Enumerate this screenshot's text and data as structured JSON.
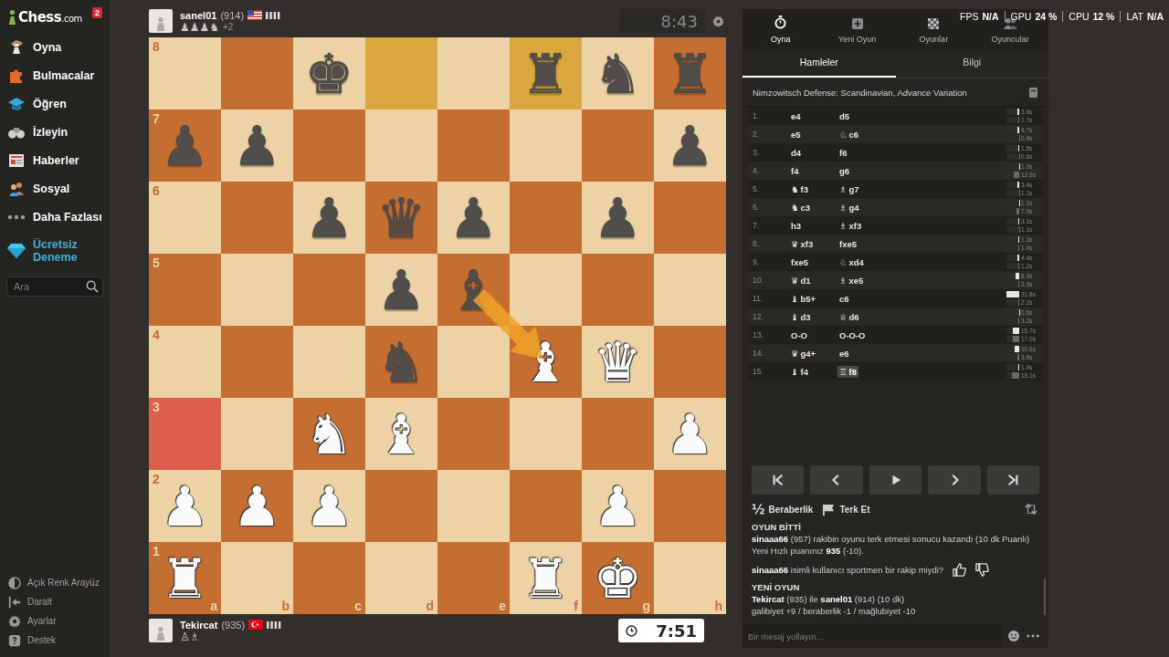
{
  "sidebar": {
    "logo": {
      "name": "Chess",
      "suffix": ".com"
    },
    "badge": "2",
    "items": [
      {
        "kind": "play",
        "label": "Oyna"
      },
      {
        "kind": "puzzles",
        "label": "Bulmacalar"
      },
      {
        "kind": "learn",
        "label": "Öğren"
      },
      {
        "kind": "watch",
        "label": "İzleyin"
      },
      {
        "kind": "news",
        "label": "Haberler"
      },
      {
        "kind": "social",
        "label": "Sosyal"
      },
      {
        "kind": "more",
        "label": "Daha Fazlası"
      },
      {
        "kind": "trial",
        "label": "Ücretsiz Deneme"
      }
    ],
    "search": {
      "placeholder": "Ara"
    },
    "footer": [
      {
        "kind": "theme",
        "label": "Açık Renk Arayüz"
      },
      {
        "kind": "collapse",
        "label": "Daralt"
      },
      {
        "kind": "settings",
        "label": "Ayarlar"
      },
      {
        "kind": "help",
        "label": "Destek"
      }
    ]
  },
  "players": [
    {
      "kind": "usa",
      "name": "sanel01",
      "rating": "(914)",
      "captured": "♟♟♟♞",
      "advantage": "+2",
      "clock": "8:43",
      "active": false
    },
    {
      "kind": "turkey",
      "name": "Tekircat",
      "rating": "(935)",
      "captured": "♙♗",
      "clock": "7:51",
      "active": true
    }
  ],
  "board": {
    "rank_labels": [
      "8",
      "7",
      "6",
      "5",
      "4",
      "3",
      "2",
      "1"
    ],
    "file_labels": [
      "a",
      "b",
      "c",
      "d",
      "e",
      "f",
      "g",
      "h"
    ],
    "rows": [
      [
        {},
        {},
        {
          "glyph": "♚",
          "white": false
        },
        {
          "last_move": true
        },
        {},
        {
          "glyph": "♜",
          "white": false,
          "last_move": true
        },
        {
          "glyph": "♞",
          "white": false
        },
        {
          "glyph": "♜",
          "white": false
        }
      ],
      [
        {
          "glyph": "♟",
          "white": false
        },
        {
          "glyph": "♟",
          "white": false
        },
        {},
        {},
        {},
        {},
        {},
        {
          "glyph": "♟",
          "white": false
        }
      ],
      [
        {},
        {},
        {
          "glyph": "♟",
          "white": false
        },
        {
          "glyph": "♛",
          "white": false
        },
        {
          "glyph": "♟",
          "white": false
        },
        {},
        {
          "glyph": "♟",
          "white": false
        },
        {}
      ],
      [
        {},
        {},
        {},
        {
          "glyph": "♟",
          "white": false
        },
        {
          "glyph": "♝",
          "white": false,
          "arrow_start": true
        },
        {},
        {},
        {}
      ],
      [
        {},
        {},
        {},
        {
          "glyph": "♞",
          "white": false
        },
        {},
        {
          "glyph": "♝",
          "white": true,
          "arrow_end": true
        },
        {
          "glyph": "♛",
          "white": true
        },
        {}
      ],
      [
        {
          "marked": true
        },
        {},
        {
          "glyph": "♞",
          "white": true
        },
        {
          "glyph": "♝",
          "white": true
        },
        {},
        {},
        {},
        {
          "glyph": "♟",
          "white": true
        }
      ],
      [
        {
          "glyph": "♟",
          "white": true
        },
        {
          "glyph": "♟",
          "white": true
        },
        {
          "glyph": "♟",
          "white": true
        },
        {},
        {},
        {},
        {
          "glyph": "♟",
          "white": true
        },
        {}
      ],
      [
        {
          "glyph": "♜",
          "white": true
        },
        {},
        {},
        {},
        {},
        {
          "glyph": "♜",
          "white": true
        },
        {
          "glyph": "♚",
          "white": true
        },
        {}
      ]
    ]
  },
  "stats": [
    {
      "label": "FPS",
      "value": "N/A"
    },
    {
      "label": "GPU",
      "value": "24 %"
    },
    {
      "label": "CPU",
      "value": "12 %"
    },
    {
      "label": "LAT",
      "value": "N/A"
    }
  ],
  "nav": [
    {
      "kind": "stopwatch",
      "label": "Oyna",
      "selected": true
    },
    {
      "kind": "plus",
      "label": "Yeni Oyun",
      "selected": false
    },
    {
      "kind": "board",
      "label": "Oyunlar",
      "selected": false
    },
    {
      "kind": "players",
      "label": "Oyuncular",
      "selected": false
    }
  ],
  "tabs": [
    {
      "label": "Hamleler",
      "selected": true
    },
    {
      "label": "Bilgi",
      "selected": false
    }
  ],
  "opening": "Nimzowitsch Defense: Scandinavian, Advance Variation",
  "moves": [
    {
      "number": "1.",
      "white": {
        "san": "e4",
        "time": "3.6s",
        "level": 0.11,
        "selected": false
      },
      "black": {
        "san": "d5",
        "time": "1.7s",
        "level": 0.05,
        "selected": false
      }
    },
    {
      "number": "2.",
      "white": {
        "san": "e5",
        "time": "4.7s",
        "level": 0.15,
        "selected": false
      },
      "black": {
        "piece": "♘",
        "san": "c6",
        "time": "0.9s",
        "level": 0.03,
        "selected": false
      }
    },
    {
      "number": "3.",
      "white": {
        "san": "d4",
        "time": "1.5s",
        "level": 0.05,
        "selected": false
      },
      "black": {
        "san": "f6",
        "time": "0.8s",
        "level": 0.03,
        "selected": false
      }
    },
    {
      "number": "4.",
      "white": {
        "san": "f4",
        "time": "1.0s",
        "level": 0.03,
        "selected": false
      },
      "black": {
        "san": "g6",
        "time": "13.9s",
        "level": 0.44,
        "selected": false
      }
    },
    {
      "number": "5.",
      "white": {
        "piece": "♞",
        "san": "f3",
        "time": "3.4s",
        "level": 0.11,
        "selected": false
      },
      "black": {
        "piece": "♗",
        "san": "g7",
        "time": "1.1s",
        "level": 0.03,
        "selected": false
      }
    },
    {
      "number": "6.",
      "white": {
        "piece": "♞",
        "san": "c3",
        "time": "1.1s",
        "level": 0.03,
        "selected": false
      },
      "black": {
        "piece": "♗",
        "san": "g4",
        "time": "7.9s",
        "level": 0.25,
        "selected": false
      }
    },
    {
      "number": "7.",
      "white": {
        "san": "h3",
        "time": "3.1s",
        "level": 0.1,
        "selected": false
      },
      "black": {
        "piece": "♗",
        "san": "xf3",
        "time": "1.1s",
        "level": 0.03,
        "selected": false
      }
    },
    {
      "number": "8.",
      "white": {
        "piece": "♛",
        "san": "xf3",
        "time": "1.3s",
        "level": 0.04,
        "selected": false
      },
      "black": {
        "san": "fxe5",
        "time": "1.4s",
        "level": 0.04,
        "selected": false
      }
    },
    {
      "number": "9.",
      "white": {
        "san": "fxe5",
        "time": "4.4s",
        "level": 0.14,
        "selected": false
      },
      "black": {
        "piece": "♘",
        "san": "xd4",
        "time": "1.2s",
        "level": 0.04,
        "selected": false
      }
    },
    {
      "number": "10.",
      "white": {
        "piece": "♛",
        "san": "d1",
        "time": "8.3s",
        "level": 0.26,
        "selected": false
      },
      "black": {
        "piece": "♗",
        "san": "xe5",
        "time": "2.3s",
        "level": 0.07,
        "selected": false
      }
    },
    {
      "number": "11.",
      "white": {
        "piece": "♝",
        "san": "b5+",
        "time": "31.8s",
        "level": 1,
        "selected": false
      },
      "black": {
        "san": "c6",
        "time": "2.2s",
        "level": 0.07,
        "selected": false
      }
    },
    {
      "number": "12.",
      "white": {
        "piece": "♝",
        "san": "d3",
        "time": "0.6s",
        "level": 0.02,
        "selected": false
      },
      "black": {
        "piece": "♕",
        "san": "d6",
        "time": "3.2s",
        "level": 0.1,
        "selected": false
      }
    },
    {
      "number": "13.",
      "white": {
        "san": "O-O",
        "time": "15.7s",
        "level": 0.49,
        "selected": false
      },
      "black": {
        "san": "O-O-O",
        "time": "17.0s",
        "level": 0.53,
        "selected": false
      }
    },
    {
      "number": "14.",
      "white": {
        "piece": "♛",
        "san": "g4+",
        "time": "10.6s",
        "level": 0.33,
        "selected": false
      },
      "black": {
        "san": "e6",
        "time": "3.6s",
        "level": 0.11,
        "selected": false
      }
    },
    {
      "number": "15.",
      "white": {
        "piece": "♝",
        "san": "f4",
        "time": "1.4s",
        "level": 0.04,
        "selected": false
      },
      "black": {
        "piece": "♖",
        "san": "f8",
        "time": "18.1s",
        "level": 0.57,
        "selected": true
      }
    }
  ],
  "controls": [
    {
      "kind": "first"
    },
    {
      "kind": "previous"
    },
    {
      "kind": "play"
    },
    {
      "kind": "next"
    },
    {
      "kind": "last"
    }
  ],
  "actions": [
    {
      "kind": "draw",
      "glyph": "½",
      "label": "Beraberlik"
    },
    {
      "kind": "resign",
      "label": "Terk Et"
    }
  ],
  "chat": [
    {
      "kind": "heading",
      "text": "OYUN BİTTİ"
    },
    {
      "kind": "text",
      "text": "**sinaaa66** (957) rakibin oyunu terk etmesi sonucu kazandı (10 dk Puanlı)"
    },
    {
      "kind": "text",
      "text": "Yeni Hızlı puanınız **935** (-10)."
    },
    {
      "kind": "feedback",
      "text": "**sinaaa66** isimli kullanıcı sportmen bir rakip miydi?"
    },
    {
      "kind": "heading",
      "text": "YENİ OYUN"
    },
    {
      "kind": "text",
      "text": "**Tekircat** (935) ile **sanel01** (914) (10 dk)"
    },
    {
      "kind": "text",
      "text": "galibiyet +9 / beraberlik -1 / mağlubiyet -10"
    }
  ],
  "chat_input": {
    "placeholder": "Bir mesaj yollayın..."
  }
}
